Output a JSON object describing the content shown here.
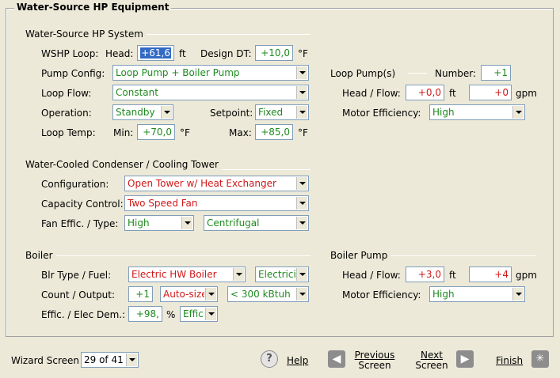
{
  "window_title": "Water-Source HP Equipment",
  "wshp_system": {
    "title": "Water-Source HP System",
    "wshp_loop_label": "WSHP Loop:",
    "head_label": "Head:",
    "head_value": "+61,6",
    "head_unit": "ft",
    "design_dt_label": "Design DT:",
    "design_dt_value": "+10,0",
    "design_dt_unit": "°F",
    "pump_config_label": "Pump Config:",
    "pump_config_value": "Loop Pump + Boiler Pump",
    "loop_flow_label": "Loop Flow:",
    "loop_flow_value": "Constant",
    "operation_label": "Operation:",
    "operation_value": "Standby",
    "setpoint_label": "Setpoint:",
    "setpoint_value": "Fixed",
    "loop_temp_label": "Loop Temp:",
    "min_label": "Min:",
    "min_value": "+70,0",
    "min_unit": "°F",
    "max_label": "Max:",
    "max_value": "+85,0",
    "max_unit": "°F"
  },
  "loop_pumps": {
    "title": "Loop Pump(s)",
    "number_label": "Number:",
    "number_value": "+1",
    "head_flow_label": "Head / Flow:",
    "head_value": "+0,0",
    "head_unit": "ft",
    "flow_value": "+0",
    "flow_unit": "gpm",
    "motor_eff_label": "Motor Efficiency:",
    "motor_eff_value": "High"
  },
  "condenser": {
    "title": "Water-Cooled Condenser / Cooling Tower",
    "configuration_label": "Configuration:",
    "configuration_value": "Open Tower w/ Heat Exchanger",
    "capacity_control_label": "Capacity Control:",
    "capacity_control_value": "Two Speed Fan",
    "fan_label": "Fan Effic. / Type:",
    "fan_effic_value": "High",
    "fan_type_value": "Centrifugal"
  },
  "boiler": {
    "title": "Boiler",
    "type_fuel_label": "Blr Type / Fuel:",
    "type_value": "Electric HW Boiler",
    "fuel_value": "Electricit",
    "count_output_label": "Count / Output:",
    "count_value": "+1",
    "output_mode_value": "Auto-size",
    "output_value": "< 300 kBtuh",
    "effic_label": "Effic. / Elec Dem.:",
    "effic_value": "+98,",
    "effic_unit": "%",
    "elec_dem_value": "Effici"
  },
  "boiler_pump": {
    "title": "Boiler Pump",
    "head_flow_label": "Head / Flow:",
    "head_value": "+3,0",
    "head_unit": "ft",
    "flow_value": "+4",
    "flow_unit": "gpm",
    "motor_eff_label": "Motor Efficiency:",
    "motor_eff_value": "High"
  },
  "footer": {
    "wizard_screen_label": "Wizard Screen",
    "wizard_screen_value": "29 of 41",
    "help_label": "Help",
    "previous_label_1": "Previous",
    "previous_label_2": "Screen",
    "next_label_1": "Next",
    "next_label_2": "Screen",
    "finish_label": "Finish"
  },
  "colors": {
    "accent_green": "#1f8a1f",
    "accent_red": "#d01818",
    "selection_blue": "#316ac5",
    "background": "#ece9d8"
  },
  "icons": [
    "help-icon",
    "previous-arrow-icon",
    "next-arrow-icon",
    "finish-icon"
  ]
}
